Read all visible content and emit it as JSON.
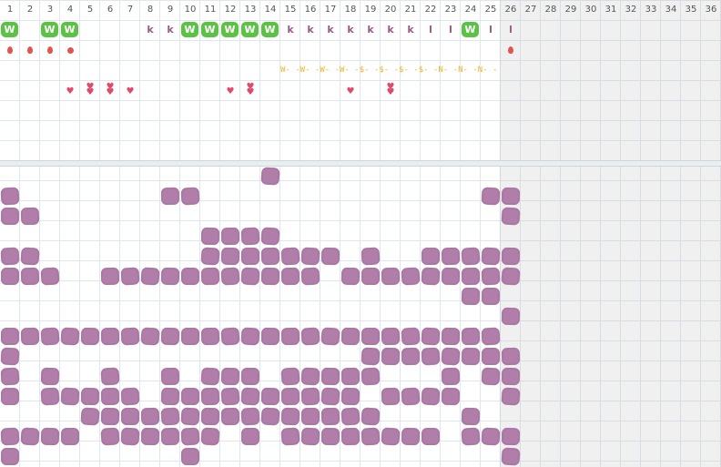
{
  "days": [
    "1",
    "2",
    "3",
    "4",
    "5",
    "6",
    "7",
    "8",
    "9",
    "10",
    "11",
    "12",
    "13",
    "14",
    "15",
    "16",
    "17",
    "18",
    "19",
    "20",
    "21",
    "22",
    "23",
    "24",
    "25",
    "26",
    "27",
    "28",
    "29",
    "30",
    "31",
    "32",
    "33",
    "34",
    "35",
    "36"
  ],
  "row1_marks": [
    {
      "day": 1,
      "text": "W",
      "kind": "w"
    },
    {
      "day": 3,
      "text": "W",
      "kind": "w"
    },
    {
      "day": 4,
      "text": "W",
      "kind": "w"
    },
    {
      "day": 8,
      "text": "k",
      "kind": "k"
    },
    {
      "day": 9,
      "text": "k",
      "kind": "k"
    },
    {
      "day": 10,
      "text": "W",
      "kind": "w"
    },
    {
      "day": 11,
      "text": "W",
      "kind": "w"
    },
    {
      "day": 12,
      "text": "W",
      "kind": "w"
    },
    {
      "day": 13,
      "text": "W",
      "kind": "w"
    },
    {
      "day": 14,
      "text": "W",
      "kind": "w"
    },
    {
      "day": 15,
      "text": "k",
      "kind": "k"
    },
    {
      "day": 16,
      "text": "k",
      "kind": "k"
    },
    {
      "day": 17,
      "text": "k",
      "kind": "k"
    },
    {
      "day": 18,
      "text": "k",
      "kind": "k"
    },
    {
      "day": 19,
      "text": "k",
      "kind": "k"
    },
    {
      "day": 20,
      "text": "k",
      "kind": "k"
    },
    {
      "day": 21,
      "text": "k",
      "kind": "k"
    },
    {
      "day": 22,
      "text": "l",
      "kind": "k"
    },
    {
      "day": 23,
      "text": "l",
      "kind": "k"
    },
    {
      "day": 24,
      "text": "W",
      "kind": "w"
    },
    {
      "day": 25,
      "text": "l",
      "kind": "k"
    },
    {
      "day": 26,
      "text": "l",
      "kind": "k"
    }
  ],
  "row2_marks": [
    {
      "day": 1,
      "kind": "drop"
    },
    {
      "day": 2,
      "kind": "drop"
    },
    {
      "day": 3,
      "kind": "drop"
    },
    {
      "day": 4,
      "kind": "dot"
    },
    {
      "day": 26,
      "kind": "drop"
    }
  ],
  "trail_text": "W- -W- -W- -W- -$- -$- -$- -$- -N- -N- -N- -",
  "hearts": [
    {
      "day": 4,
      "glyph": "♥"
    },
    {
      "day": 5,
      "glyph": "♥♥"
    },
    {
      "day": 6,
      "glyph": "♥♥"
    },
    {
      "day": 7,
      "glyph": "♥"
    },
    {
      "day": 12,
      "glyph": "♥"
    },
    {
      "day": 13,
      "glyph": "♥♥"
    },
    {
      "day": 18,
      "glyph": "♥"
    },
    {
      "day": 20,
      "glyph": "♥♥"
    }
  ],
  "blob_rows": [
    [
      14
    ],
    [
      1,
      9,
      10,
      25,
      26
    ],
    [
      1,
      2,
      26
    ],
    [
      11,
      12,
      13,
      14
    ],
    [
      1,
      2,
      11,
      12,
      13,
      14,
      15,
      16,
      17,
      19,
      22,
      23,
      24,
      25,
      26
    ],
    [
      1,
      2,
      3,
      6,
      7,
      8,
      9,
      10,
      11,
      12,
      13,
      14,
      15,
      16,
      18,
      19,
      20,
      21,
      22,
      23,
      24,
      25,
      26
    ],
    [
      24,
      25
    ],
    [
      26
    ],
    [
      1,
      2,
      3,
      4,
      5,
      6,
      7,
      8,
      9,
      10,
      11,
      12,
      13,
      14,
      15,
      16,
      17,
      18,
      19,
      20,
      21,
      22,
      23,
      24,
      25
    ],
    [
      1,
      19,
      20,
      21,
      22,
      23,
      24,
      25,
      26
    ],
    [
      1,
      3,
      6,
      9,
      11,
      12,
      13,
      15,
      16,
      17,
      18,
      19,
      23,
      25,
      26
    ],
    [
      1,
      3,
      4,
      5,
      6,
      7,
      9,
      10,
      11,
      12,
      13,
      14,
      15,
      16,
      17,
      18,
      20,
      21,
      22,
      23,
      26
    ],
    [
      5,
      6,
      7,
      8,
      9,
      10,
      11,
      12,
      13,
      14,
      15,
      16,
      17,
      18,
      19,
      24
    ],
    [
      1,
      2,
      3,
      4,
      6,
      7,
      8,
      9,
      10,
      11,
      13,
      15,
      16,
      17,
      18,
      19,
      20,
      21,
      22,
      24,
      25,
      26
    ],
    [
      1,
      10,
      26
    ]
  ],
  "colors": {
    "grid": "#dde7ec",
    "w_badge": "#5cc245",
    "k_letter": "#9a5a86",
    "drop": "#e0554e",
    "heart": "#e04a6a",
    "trail": "#f0b429",
    "blob": "#b07ea9"
  },
  "icons": {
    "drop": "drop-icon",
    "dot": "dot-icon",
    "heart": "heart-icon",
    "blob": "scribble-blob-icon"
  }
}
